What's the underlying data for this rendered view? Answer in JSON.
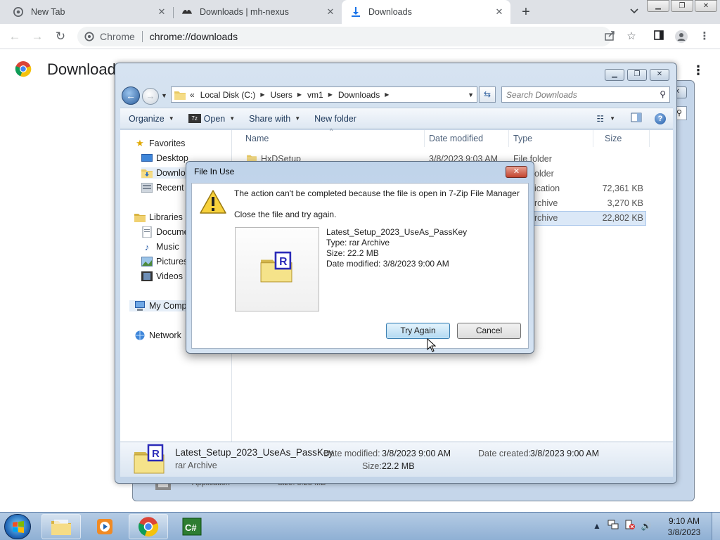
{
  "chrome": {
    "tabs": [
      {
        "title": "New Tab",
        "icon": "chrome-icon"
      },
      {
        "title": "Downloads | mh-nexus",
        "icon": "mh-nexus-icon"
      },
      {
        "title": "Downloads",
        "icon": "download-icon"
      }
    ],
    "omnibox": {
      "chip": "Chrome",
      "url": "chrome://downloads"
    },
    "page_title": "Download"
  },
  "background_explorer": {
    "peek_type": "Application",
    "peek_size": "Size: 5.28 MB"
  },
  "explorer": {
    "address": {
      "prefix": "«",
      "crumbs": [
        "Local Disk (C:)",
        "Users",
        "vm1",
        "Downloads"
      ]
    },
    "search": {
      "placeholder": "Search Downloads"
    },
    "commands": {
      "organize": "Organize",
      "open": "Open",
      "share": "Share with",
      "new_folder": "New folder"
    },
    "nav": {
      "favorites": "Favorites",
      "desktop": "Desktop",
      "downloads": "Downlo",
      "recent": "Recent P",
      "libraries": "Libraries",
      "documents": "Docume",
      "music": "Music",
      "pictures": "Pictures",
      "videos": "Videos",
      "computer": "My Comp",
      "network": "Network"
    },
    "columns": {
      "name": "Name",
      "date": "Date modified",
      "type": "Type",
      "size": "Size"
    },
    "rows": [
      {
        "name": "HxDSetup",
        "date": "3/8/2023 9:03 AM",
        "type": "File folder",
        "size": ""
      },
      {
        "name": "",
        "date": "",
        "type": "older",
        "size": ""
      },
      {
        "name": "",
        "date": "",
        "type": "ication",
        "size": "72,361 KB"
      },
      {
        "name": "",
        "date": "",
        "type": "rchive",
        "size": "3,270 KB"
      },
      {
        "name": "",
        "date": "",
        "type": "rchive",
        "size": "22,802 KB"
      }
    ],
    "details": {
      "name": "Latest_Setup_2023_UseAs_PassKey",
      "type": "rar Archive",
      "date_modified_label": "Date modified:",
      "date_modified": "3/8/2023 9:00 AM",
      "date_created_label": "Date created:",
      "date_created": "3/8/2023 9:00 AM",
      "size_label": "Size:",
      "size": "22.2 MB"
    }
  },
  "dialog": {
    "title": "File In Use",
    "message": "The action can't be completed because the file is open in 7-Zip File Manager",
    "instruction": "Close the file and try again.",
    "file_name": "Latest_Setup_2023_UseAs_PassKey",
    "file_type": "Type: rar Archive",
    "file_size": "Size: 22.2 MB",
    "file_date": "Date modified: 3/8/2023 9:00 AM",
    "try_again": "Try Again",
    "cancel": "Cancel"
  },
  "taskbar": {
    "apps": [
      "windows-explorer-icon",
      "media-player-icon",
      "chrome-icon",
      "csharp-icon"
    ],
    "time": "9:10 AM",
    "date": "3/8/2023"
  },
  "colors": {
    "accent": "#1f5aa6",
    "rar_blue": "#2b2bb8",
    "folder_yellow": "#f5e38a"
  }
}
